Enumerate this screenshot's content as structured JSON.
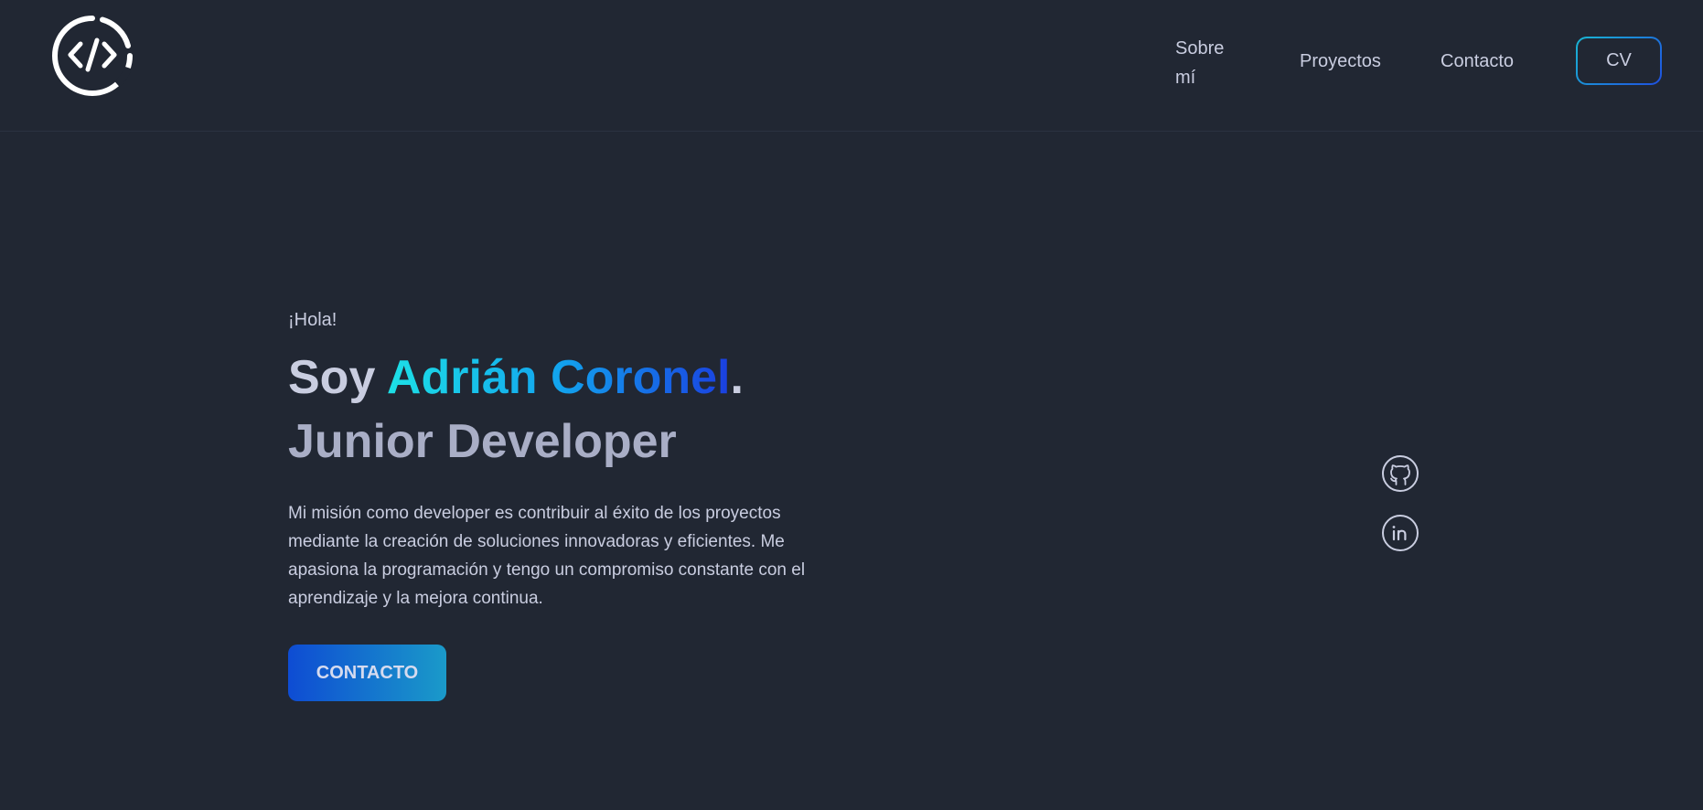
{
  "header": {
    "logo_icon": "code-brackets-icon",
    "nav": {
      "about": "Sobre mí",
      "projects": "Proyectos",
      "contact": "Contacto"
    },
    "cv_label": "CV"
  },
  "hero": {
    "greeting": "¡Hola!",
    "title_prefix": "Soy ",
    "name": "Adrián Coronel",
    "title_suffix": ".",
    "subtitle": "Junior Developer",
    "mission": "Mi misión como developer es contribuir al éxito de los proyectos mediante la creación de soluciones innovadoras y eficientes. Me apasiona la programación y tengo un compromiso constante con el aprendizaje y la mejora continua.",
    "contact_button": "CONTACTO"
  },
  "social": [
    {
      "icon": "github-icon"
    },
    {
      "icon": "linkedin-icon"
    }
  ],
  "colors": {
    "background": "#212733",
    "text": "#c9cde0",
    "accent_start": "#1de0e6",
    "accent_end": "#1a3fe0"
  }
}
